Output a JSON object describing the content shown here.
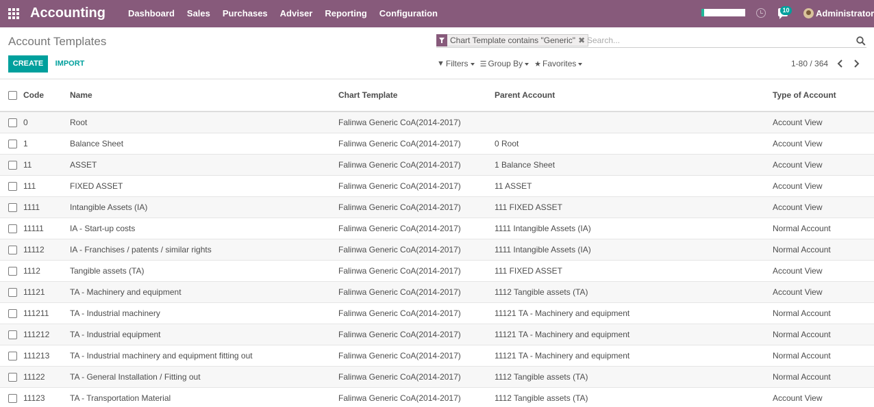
{
  "navbar": {
    "app_name": "Accounting",
    "menu": [
      "Dashboard",
      "Sales",
      "Purchases",
      "Adviser",
      "Reporting",
      "Configuration"
    ],
    "notification_count": "10",
    "user_name": "Administrator",
    "colors": {
      "brand": "#875a7b",
      "accent": "#00a09d",
      "progress": "#21b799"
    }
  },
  "control_panel": {
    "breadcrumb": "Account Templates",
    "facet_label": "Chart Template contains \"Generic\"",
    "search_placeholder": "Search...",
    "create_label": "CREATE",
    "import_label": "IMPORT",
    "filters_label": "Filters",
    "group_by_label": "Group By",
    "favorites_label": "Favorites",
    "pager": "1-80 / 364"
  },
  "table": {
    "columns": [
      "Code",
      "Name",
      "Chart Template",
      "Parent Account",
      "Type of Account"
    ],
    "rows": [
      [
        "0",
        "Root",
        "Falinwa Generic CoA(2014-2017)",
        "",
        "Account View"
      ],
      [
        "1",
        "Balance Sheet",
        "Falinwa Generic CoA(2014-2017)",
        "0 Root",
        "Account View"
      ],
      [
        "11",
        "ASSET",
        "Falinwa Generic CoA(2014-2017)",
        "1 Balance Sheet",
        "Account View"
      ],
      [
        "111",
        "FIXED ASSET",
        "Falinwa Generic CoA(2014-2017)",
        "11 ASSET",
        "Account View"
      ],
      [
        "1111",
        "Intangible Assets (IA)",
        "Falinwa Generic CoA(2014-2017)",
        "111 FIXED ASSET",
        "Account View"
      ],
      [
        "11111",
        "IA - Start-up costs",
        "Falinwa Generic CoA(2014-2017)",
        "1111 Intangible Assets (IA)",
        "Normal Account"
      ],
      [
        "11112",
        "IA - Franchises / patents / similar rights",
        "Falinwa Generic CoA(2014-2017)",
        "1111 Intangible Assets (IA)",
        "Normal Account"
      ],
      [
        "1112",
        "Tangible assets (TA)",
        "Falinwa Generic CoA(2014-2017)",
        "111 FIXED ASSET",
        "Account View"
      ],
      [
        "11121",
        "TA - Machinery and equipment",
        "Falinwa Generic CoA(2014-2017)",
        "1112 Tangible assets (TA)",
        "Account View"
      ],
      [
        "111211",
        "TA - Industrial machinery",
        "Falinwa Generic CoA(2014-2017)",
        "11121 TA - Machinery and equipment",
        "Normal Account"
      ],
      [
        "111212",
        "TA - Industrial equipment",
        "Falinwa Generic CoA(2014-2017)",
        "11121 TA - Machinery and equipment",
        "Normal Account"
      ],
      [
        "111213",
        "TA - Industrial machinery and equipment fitting out",
        "Falinwa Generic CoA(2014-2017)",
        "11121 TA - Machinery and equipment",
        "Normal Account"
      ],
      [
        "11122",
        "TA - General Installation / Fitting out",
        "Falinwa Generic CoA(2014-2017)",
        "1112 Tangible assets (TA)",
        "Normal Account"
      ],
      [
        "11123",
        "TA - Transportation Material",
        "Falinwa Generic CoA(2014-2017)",
        "1112 Tangible assets (TA)",
        "Account View"
      ]
    ]
  }
}
